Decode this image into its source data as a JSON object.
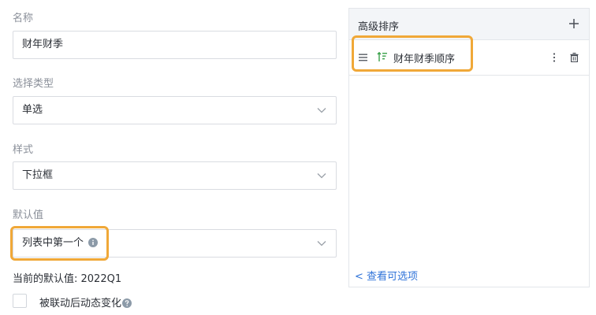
{
  "form": {
    "name_label": "名称",
    "name_value": "财年财季",
    "select_type_label": "选择类型",
    "select_type_value": "单选",
    "style_label": "样式",
    "style_value": "下拉框",
    "default_label": "默认值",
    "default_value": "列表中第一个",
    "current_default": "当前的默认值: 2022Q1",
    "checkbox_label": "被联动后动态变化"
  },
  "sort_panel": {
    "title": "高级排序",
    "items": [
      {
        "label": "财年财季顺序"
      }
    ],
    "view_options_link": "查看可选项"
  },
  "colors": {
    "accent": "#2f73d9",
    "highlight": "#f0a838",
    "sort_icon": "#3aa14a"
  }
}
